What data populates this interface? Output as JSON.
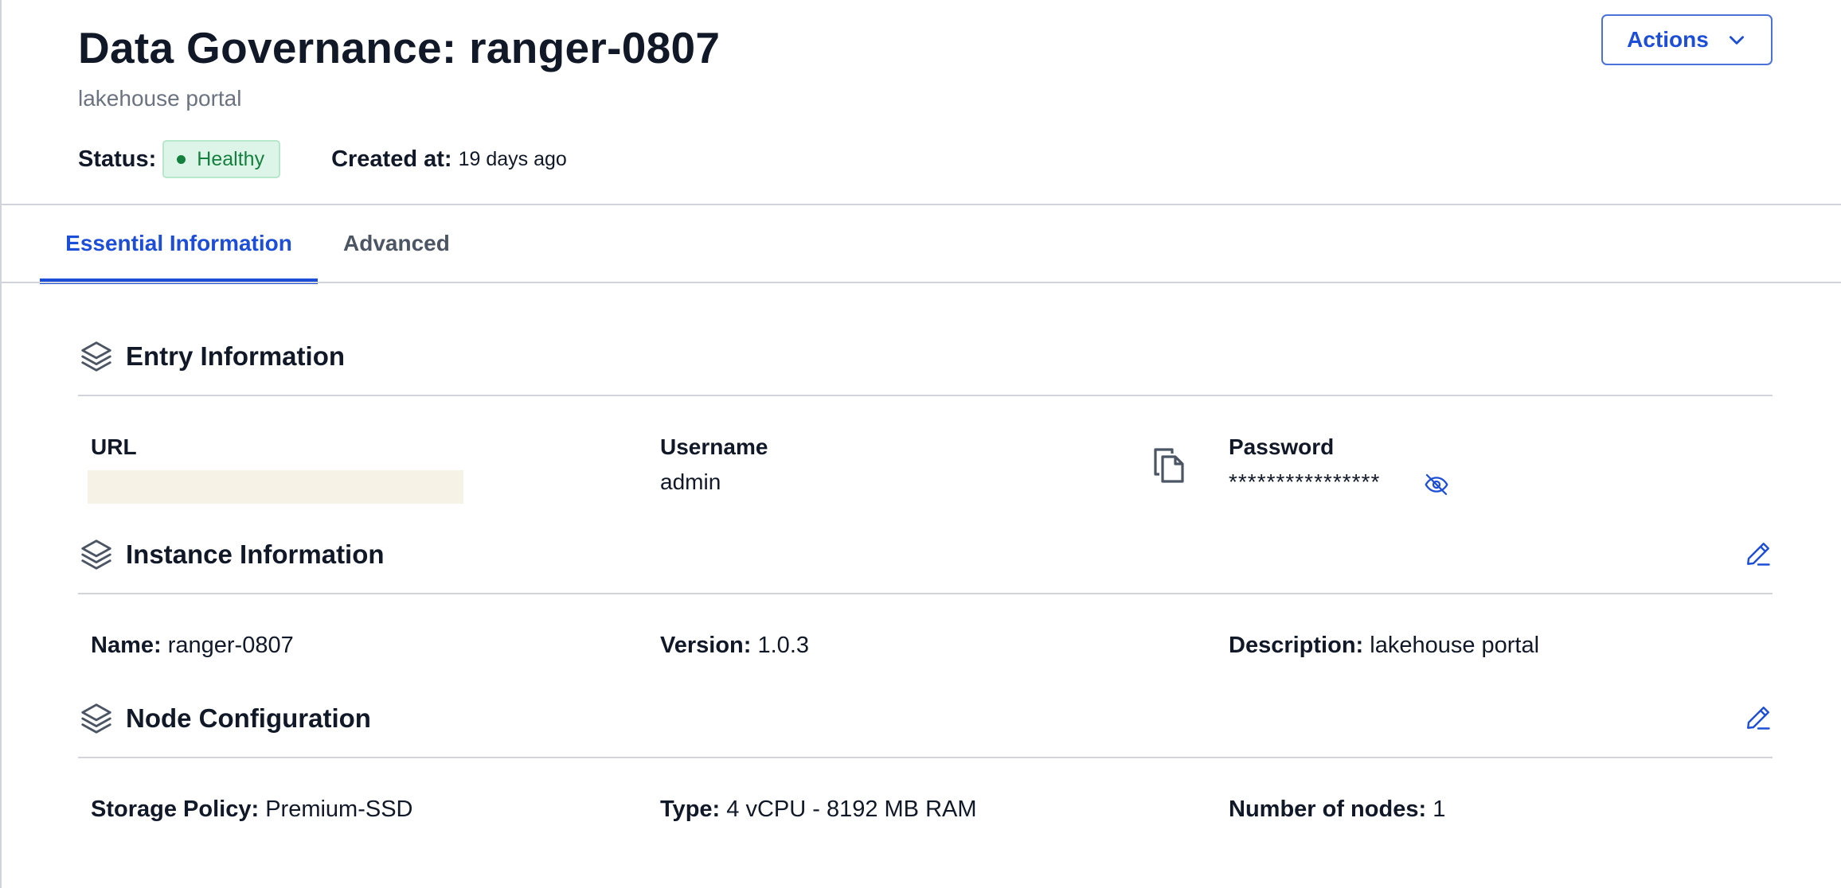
{
  "header": {
    "title": "Data Governance: ranger-0807",
    "subtitle": "lakehouse portal",
    "status_label": "Status:",
    "status_value": "Healthy",
    "created_label": "Created at:",
    "created_value": "19 days ago",
    "actions_label": "Actions"
  },
  "tabs": [
    {
      "label": "Essential Information",
      "active": true
    },
    {
      "label": "Advanced",
      "active": false
    }
  ],
  "entry": {
    "title": "Entry Information",
    "url_label": "URL",
    "username_label": "Username",
    "username_value": "admin",
    "password_label": "Password",
    "password_value": "****************"
  },
  "instance": {
    "title": "Instance Information",
    "name_label": "Name:",
    "name_value": "ranger-0807",
    "version_label": "Version:",
    "version_value": "1.0.3",
    "description_label": "Description:",
    "description_value": "lakehouse portal"
  },
  "node": {
    "title": "Node Configuration",
    "storage_label": "Storage Policy:",
    "storage_value": "Premium-SSD",
    "type_label": "Type:",
    "type_value": "4 vCPU - 8192 MB RAM",
    "nodes_label": "Number of nodes:",
    "nodes_value": "1"
  },
  "icons": {
    "section": "layers-icon",
    "edit": "pencil-icon",
    "copy": "copy-icon",
    "reveal": "eye-off-icon",
    "dropdown": "chevron-down-icon"
  },
  "colors": {
    "accent": "#1d4ed8",
    "status_bg": "#dcf5e8",
    "status_text": "#15803d",
    "divider": "#d1d5db",
    "muted_text": "#6b7280"
  }
}
